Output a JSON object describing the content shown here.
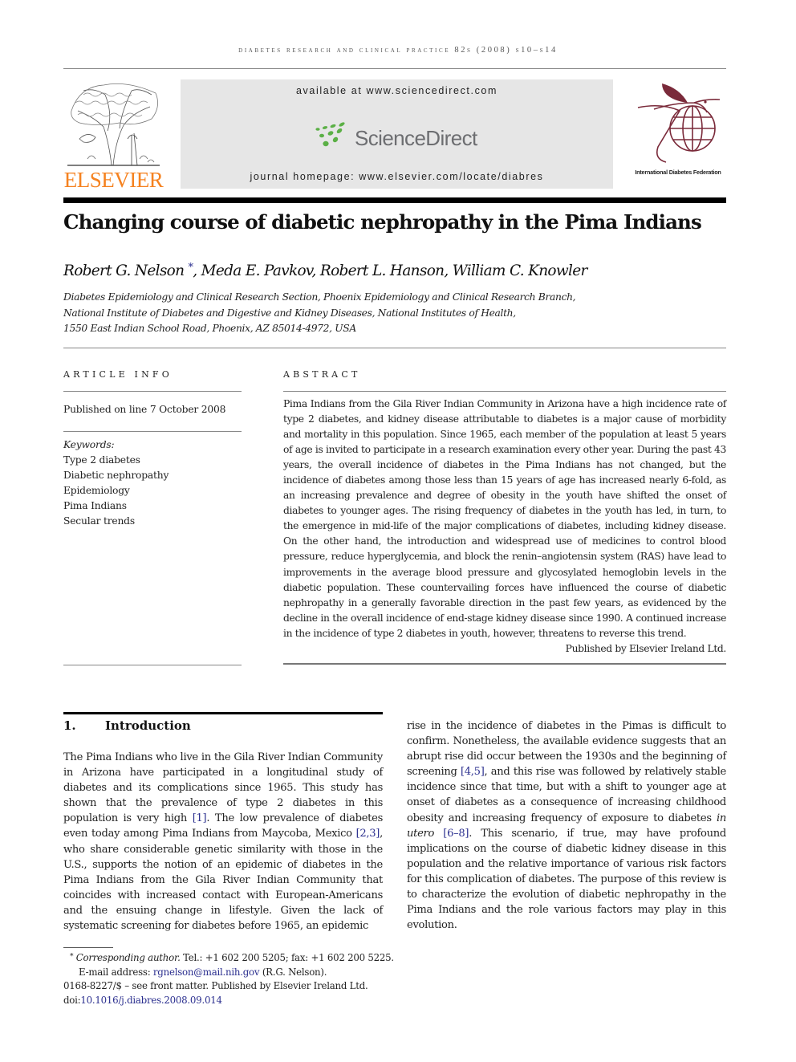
{
  "running_head": "diabetes research and clinical practice 82s (2008) s10–s14",
  "header": {
    "publisher_logo_text": "ELSEVIER",
    "sciencedirect": {
      "available_at": "available at www.sciencedirect.com",
      "logo_text": "ScienceDirect",
      "journal_homepage": "journal homepage: www.elsevier.com/locate/diabres"
    },
    "society_logo_text": "International Diabetes Federation",
    "colors": {
      "elsevier_orange": "#f58220",
      "sciencedirect_green": "#5bb046",
      "idf_maroon": "#7a2a3a",
      "link_blue": "#2b2f8f"
    }
  },
  "article": {
    "title": "Changing course of diabetic nephropathy in the Pima Indians",
    "authors": [
      {
        "name": "Robert G. Nelson",
        "mark": "*"
      },
      {
        "name": "Meda E. Pavkov"
      },
      {
        "name": "Robert L. Hanson"
      },
      {
        "name": "William C. Knowler"
      }
    ],
    "author_separator": ", ",
    "affiliation_lines": [
      "Diabetes Epidemiology and Clinical Research Section, Phoenix Epidemiology and Clinical Research Branch,",
      "National Institute of Diabetes and Digestive and Kidney Diseases, National Institutes of Health,",
      "1550 East Indian School Road, Phoenix, AZ 85014-4972, USA"
    ]
  },
  "article_info": {
    "heading": "ARTICLE INFO",
    "published": "Published on line 7 October 2008",
    "keywords_label": "Keywords:",
    "keywords": [
      "Type 2 diabetes",
      "Diabetic nephropathy",
      "Epidemiology",
      "Pima Indians",
      "Secular trends"
    ]
  },
  "abstract": {
    "heading": "ABSTRACT",
    "text": "Pima Indians from the Gila River Indian Community in Arizona have a high incidence rate of type 2 diabetes, and kidney disease attributable to diabetes is a major cause of morbidity and mortality in this population. Since 1965, each member of the population at least 5 years of age is invited to participate in a research examination every other year. During the past 43 years, the overall incidence of diabetes in the Pima Indians has not changed, but the incidence of diabetes among those less than 15 years of age has increased nearly 6-fold, as an increasing prevalence and degree of obesity in the youth have shifted the onset of diabetes to younger ages. The rising frequency of diabetes in the youth has led, in turn, to the emergence in mid-life of the major complications of diabetes, including kidney disease. On the other hand, the introduction and widespread use of medicines to control blood pressure, reduce hyperglycemia, and block the renin–angiotensin system (RAS) have lead to improvements in the average blood pressure and glycosylated hemoglobin levels in the diabetic population. These countervailing forces have influenced the course of diabetic nephropathy in a generally favorable direction in the past few years, as evidenced by the decline in the overall incidence of end-stage kidney disease since 1990. A continued increase in the incidence of type 2 diabetes in youth, however, threatens to reverse this trend.",
    "publisher": "Published by Elsevier Ireland Ltd."
  },
  "introduction": {
    "number": "1.",
    "heading": "Introduction",
    "col1": [
      {
        "t": "The Pima Indians who live in the Gila River Indian Community in Arizona have participated in a longitudinal study of diabetes and its complications since 1965. This study has shown that the prevalence of type 2 diabetes in this population is very high "
      },
      {
        "t": "[1]",
        "ref": true
      },
      {
        "t": ". The low prevalence of diabetes even today among Pima Indians from Maycoba, Mexico "
      },
      {
        "t": "[2,3]",
        "ref": true
      },
      {
        "t": ", who share considerable genetic similarity with those in the U.S., supports the notion of an epidemic of diabetes in the Pima Indians from the Gila River Indian Community that coincides with increased contact with European-Americans and the ensuing change in lifestyle. Given the lack of systematic screening for diabetes before 1965, an epidemic"
      }
    ],
    "col2": [
      {
        "t": "rise in the incidence of diabetes in the Pimas is difficult to confirm. Nonetheless, the available evidence suggests that an abrupt rise did occur between the 1930s and the beginning of screening "
      },
      {
        "t": "[4,5]",
        "ref": true
      },
      {
        "t": ", and this rise was followed by relatively stable incidence since that time, but with a shift to younger age at onset of diabetes as a consequence of increasing childhood obesity and increasing frequency of exposure to diabetes "
      },
      {
        "t": "in utero",
        "ital": true
      },
      {
        "t": " "
      },
      {
        "t": "[6–8]",
        "ref": true
      },
      {
        "t": ". This scenario, if true, may have profound implications on the course of diabetic kidney disease in this population and the relative importance of various risk factors for this complication of diabetes. The purpose of this review is to characterize the evolution of diabetic nephropathy in the Pima Indians and the role various factors may play in this evolution."
      }
    ]
  },
  "footnote": {
    "mark": "*",
    "corresponding_label": "Corresponding author.",
    "contact": " Tel.: +1 602 200 5205; fax: +1 602 200 5225.",
    "email_label": "E-mail address: ",
    "email": "rgnelson@mail.nih.gov",
    "email_suffix": " (R.G. Nelson).",
    "issn_line": "0168-8227/$ – see front matter. Published by Elsevier Ireland Ltd.",
    "doi_label": "doi:",
    "doi": "10.1016/j.diabres.2008.09.014"
  }
}
